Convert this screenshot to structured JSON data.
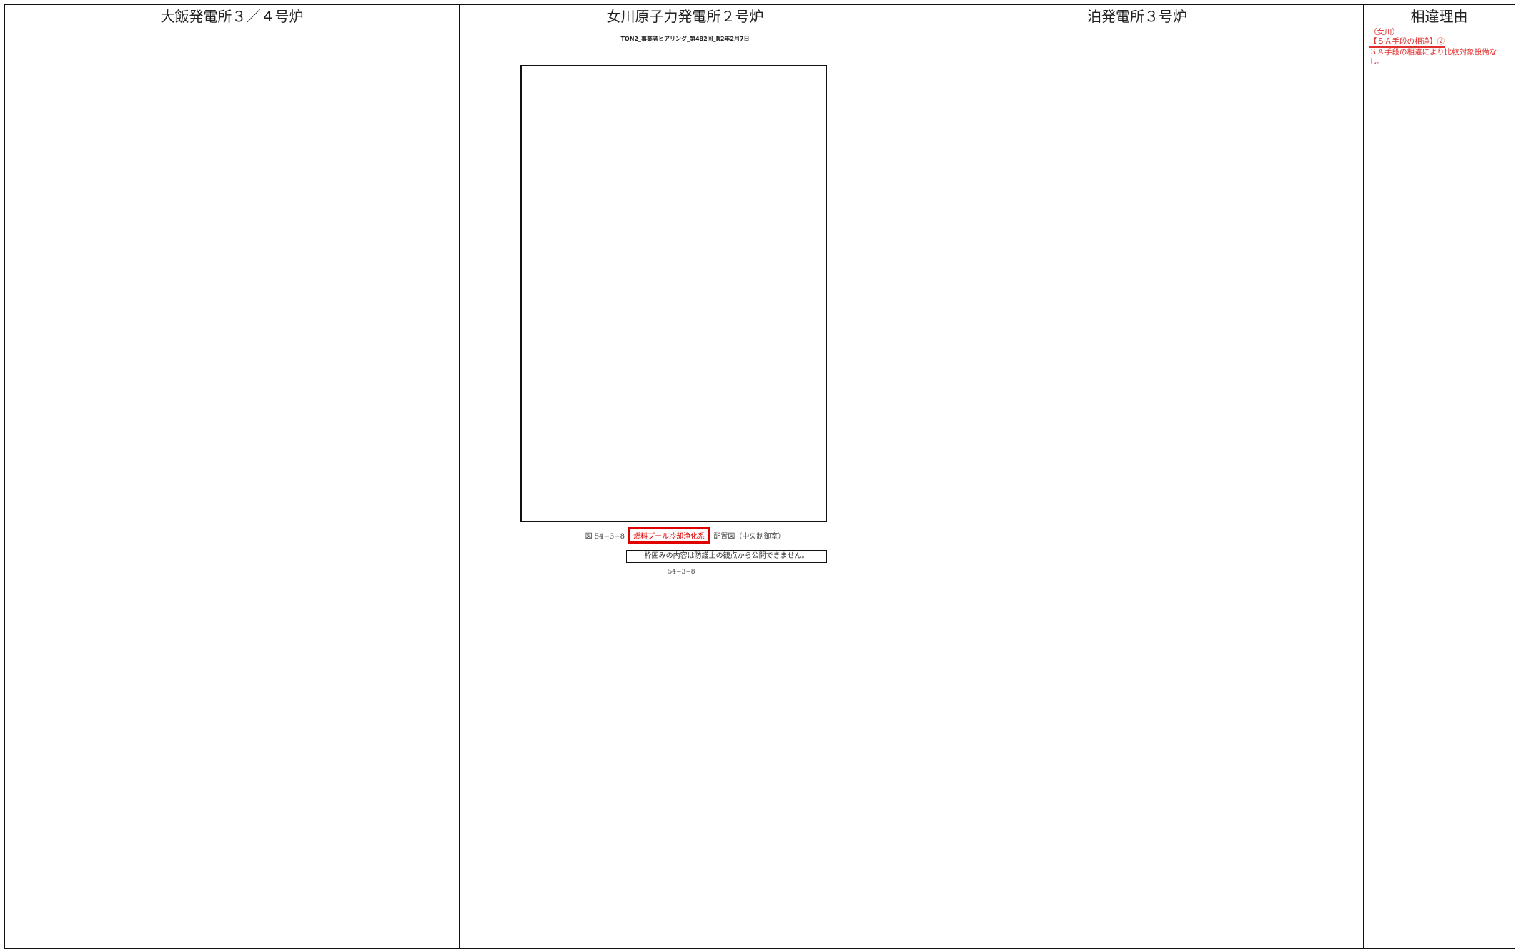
{
  "headers": {
    "col1": "大飯発電所３／４号炉",
    "col2": "女川原子力発電所２号炉",
    "col3": "泊発電所３号炉",
    "col4": "相違理由"
  },
  "onagawa": {
    "doc_header": "TON2_事業者ヒアリング_第482回_R2年2月7日",
    "caption_prefix": "図 54−3−8",
    "caption_highlight": "燃料プール冷却浄化系",
    "caption_suffix": "配置図（中央制御室）",
    "security_note": "枠囲みの内容は防護上の観点から公開できません。",
    "page_number": "54−3−8"
  },
  "reason": {
    "line1": "（女川）",
    "tag": "【ＳＡ手段の相違】②",
    "line3": "ＳＡ手段の相違により比較対象設備なし。"
  }
}
